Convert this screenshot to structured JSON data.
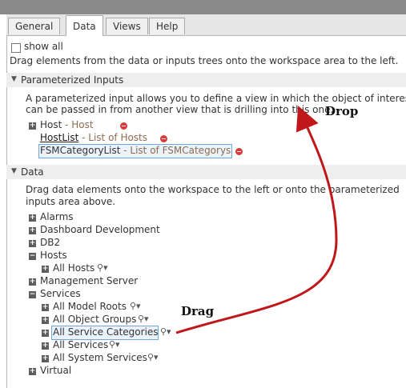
{
  "tabs": [
    {
      "label": "General"
    },
    {
      "label": "Data"
    },
    {
      "label": "Views"
    },
    {
      "label": "Help"
    }
  ],
  "show_all_label": "show all",
  "drag_instruction": "Drag elements from the data or inputs trees onto the workspace area to the left.",
  "param_section": {
    "title": "Parameterized Inputs",
    "description_line1": "A parameterized input allows you to define a view in which the object of interest",
    "description_line2": "can be passed in from another view that is drilling into this one.",
    "inputs": [
      {
        "name": "Host",
        "type": " - Host"
      },
      {
        "name": "HostList",
        "type": " - List of Hosts"
      },
      {
        "name": "FSMCategoryList",
        "type": " - List of FSMCategorys"
      }
    ]
  },
  "data_section": {
    "title": "Data",
    "description_line1": "Drag data elements onto the workspace to the left or onto the parameterized",
    "description_line2": "inputs area above.",
    "tree": {
      "alarms": "Alarms",
      "dashboard": "Dashboard Development",
      "db2": "DB2",
      "hosts": "Hosts",
      "all_hosts": "All Hosts",
      "mgmt": "Management Server",
      "services": "Services",
      "all_model_roots": "All Model Roots",
      "all_object_groups": "All Object Groups",
      "all_service_categories": "All Service Categories",
      "all_services": "All Services",
      "all_system_services": "All System Services",
      "virtual": "Virtual"
    }
  },
  "annotations": {
    "drop": "Drop",
    "drag": "Drag"
  },
  "colors": {
    "arrow": "#c0171b",
    "remove_icon": "#d83a3a",
    "selection": "#6fa8dc"
  }
}
